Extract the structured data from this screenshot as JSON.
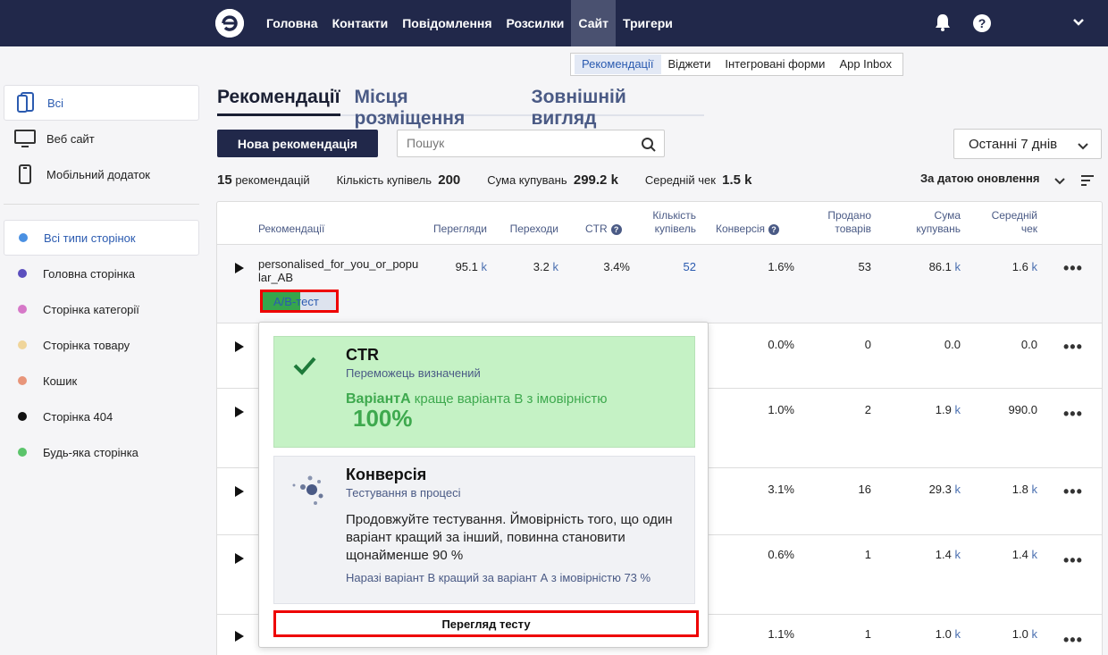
{
  "topbar": {
    "nav": [
      {
        "label": "Головна",
        "active": false
      },
      {
        "label": "Контакти",
        "active": false
      },
      {
        "label": "Повідомлення",
        "active": false
      },
      {
        "label": "Розсилки",
        "active": false
      },
      {
        "label": "Сайт",
        "active": true
      },
      {
        "label": "Тригери",
        "active": false
      }
    ],
    "icons": [
      "logo-icon",
      "bell-icon",
      "help-icon",
      "chevron-down-icon"
    ],
    "help_label": "?"
  },
  "subtabs": [
    "Рекомендації",
    "Віджети",
    "Інтегровані форми",
    "App Inbox"
  ],
  "sidebar": {
    "platforms": [
      {
        "label": "Всі",
        "icon": "all-devices-icon",
        "active": true
      },
      {
        "label": "Веб сайт",
        "icon": "monitor-icon",
        "active": false
      },
      {
        "label": "Мобільний додаток",
        "icon": "phone-icon",
        "active": false
      }
    ],
    "page_types": [
      {
        "label": "Всі типи сторінок",
        "color": "#4a90e2",
        "active": true
      },
      {
        "label": "Головна сторінка",
        "color": "#5b4fbe",
        "active": false
      },
      {
        "label": "Сторінка категорії",
        "color": "#d678c8",
        "active": false
      },
      {
        "label": "Сторінка товару",
        "color": "#f0d59a",
        "active": false
      },
      {
        "label": "Кошик",
        "color": "#e8957a",
        "active": false
      },
      {
        "label": "Сторінка 404",
        "color": "#111111",
        "active": false
      },
      {
        "label": "Будь-яка сторінка",
        "color": "#5bc46b",
        "active": false
      }
    ]
  },
  "tabs": [
    "Рекомендації",
    "Місця розміщення",
    "Зовнішній вигляд"
  ],
  "toolbar": {
    "new_button": "Нова рекомендація",
    "search_placeholder": "Пошук",
    "period": "Останні 7 днів"
  },
  "stats": {
    "count_value": "15",
    "count_label": "рекомендацій",
    "purchases_label": "Кількість купівель",
    "purchases_value": "200",
    "sum_label": "Сума купувань",
    "sum_value": "299.2 k",
    "avg_label": "Середній чек",
    "avg_value": "1.5 k",
    "sort_label": "За датою оновлення"
  },
  "table": {
    "headers": {
      "name": "Рекомендації",
      "views": "Перегляди",
      "clicks": "Переходи",
      "ctr": "CTR",
      "purchases_1": "Кількість",
      "purchases_2": "купівель",
      "conversion": "Конверсія",
      "sold_1": "Продано",
      "sold_2": "товарів",
      "sum_1": "Сума",
      "sum_2": "купувань",
      "avg_1": "Середній",
      "avg_2": "чек",
      "qmark": "?"
    },
    "rows": [
      {
        "name": "personalised_for_you_or_popular_AB",
        "views": "95.1",
        "clicks": "3.2",
        "ctr": "3.4%",
        "purchases": "52",
        "conversion": "1.6%",
        "sold": "53",
        "sum": "86.1",
        "avg": "1.6"
      },
      {
        "conversion": "0.0%",
        "sold": "0",
        "sum": "0.0",
        "avg": "0.0"
      },
      {
        "conversion": "1.0%",
        "sold": "2",
        "sum": "1.9",
        "avg": "990.0"
      },
      {
        "conversion": "3.1%",
        "sold": "16",
        "sum": "29.3",
        "avg": "1.8"
      },
      {
        "conversion": "0.6%",
        "sold": "1",
        "sum": "1.4",
        "avg": "1.4"
      },
      {
        "conversion": "1.1%",
        "sold": "1",
        "sum": "1.0",
        "avg": "1.0"
      }
    ],
    "k_suffix": "k",
    "ab_badge": "A/B-тест",
    "more": "•••"
  },
  "popup": {
    "ctr_title": "CTR",
    "ctr_sub": "Переможець визначений",
    "ctr_variant": "ВаріантА",
    "ctr_line": " краще варіанта В з імовірністю",
    "ctr_pct": "100%",
    "conv_title": "Конверсія",
    "conv_sub": "Тестування в процесі",
    "conv_text": "Продовжуйте тестування. Ймовірність того, що один варіант кращий за інший, повинна становити щонайменше 90 %",
    "conv_now": "Наразі варіант В кращий за варіант А з імовірністю 73 %",
    "view_button": "Перегляд тесту"
  },
  "colors": {
    "navbar": "#21284a",
    "accent": "#2b5bb0",
    "win_bg": "#c5f2c5",
    "win_text": "#3ea94e",
    "highlight": "#e00000"
  }
}
